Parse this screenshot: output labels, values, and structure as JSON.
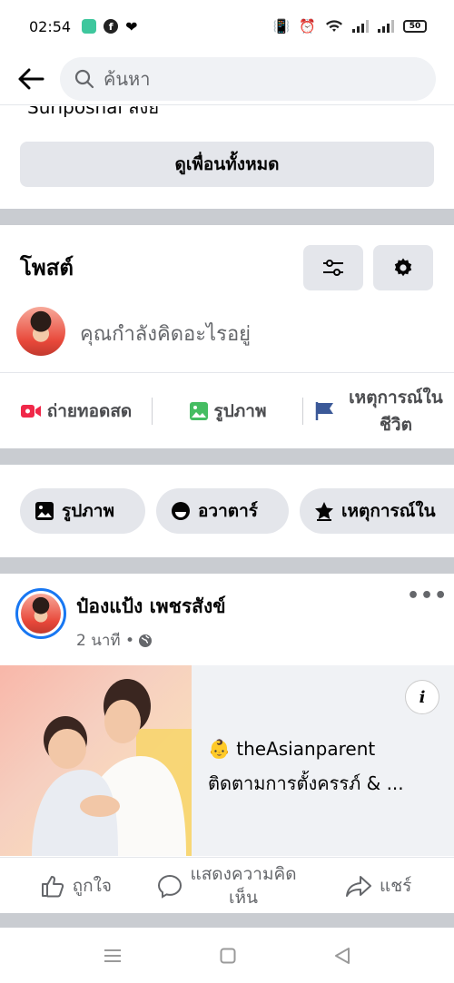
{
  "status_bar": {
    "time": "02:54",
    "battery": "50"
  },
  "search": {
    "placeholder": "ค้นหา"
  },
  "friends": {
    "partial_text": "Suriposnai    สงย",
    "see_all_label": "ดูเพื่อนทั้งหมด"
  },
  "posts": {
    "title": "โพสต์",
    "composer_placeholder": "คุณกำลังคิดอะไรอยู่"
  },
  "actions": [
    {
      "label": "ถ่ายทอดสด",
      "icon": "live-video-icon"
    },
    {
      "label": "รูปภาพ",
      "icon": "photo-icon"
    },
    {
      "label": "เหตุการณ์ใน\nชีวิต",
      "icon": "life-event-flag-icon"
    }
  ],
  "pills": [
    {
      "label": "รูปภาพ",
      "icon": "photo-icon"
    },
    {
      "label": "อวาตาร์",
      "icon": "avatar-icon"
    },
    {
      "label": "เหตุการณ์ใน",
      "icon": "star-icon"
    }
  ],
  "post": {
    "author": "ป๋องแป้ง เพชรสังข์",
    "time": "2 นาที •",
    "more": "•••"
  },
  "ad": {
    "title": "👶 theAsianparent",
    "subtitle": "ติดตามการตั้งครรภ์ & ...",
    "info": "i"
  },
  "reactions": [
    {
      "label": "ถูกใจ",
      "icon": "like-icon"
    },
    {
      "label": "แสดงความคิด\nเห็น",
      "icon": "comment-icon"
    },
    {
      "label": "แชร์",
      "icon": "share-icon"
    }
  ],
  "colors": {
    "divider": "#c9ccd1",
    "button_bg": "#e4e6eb",
    "live_red": "#f02849",
    "photo_green": "#45bd62",
    "flag_blue": "#3b5998",
    "avatar_ring": "#1877f2"
  }
}
